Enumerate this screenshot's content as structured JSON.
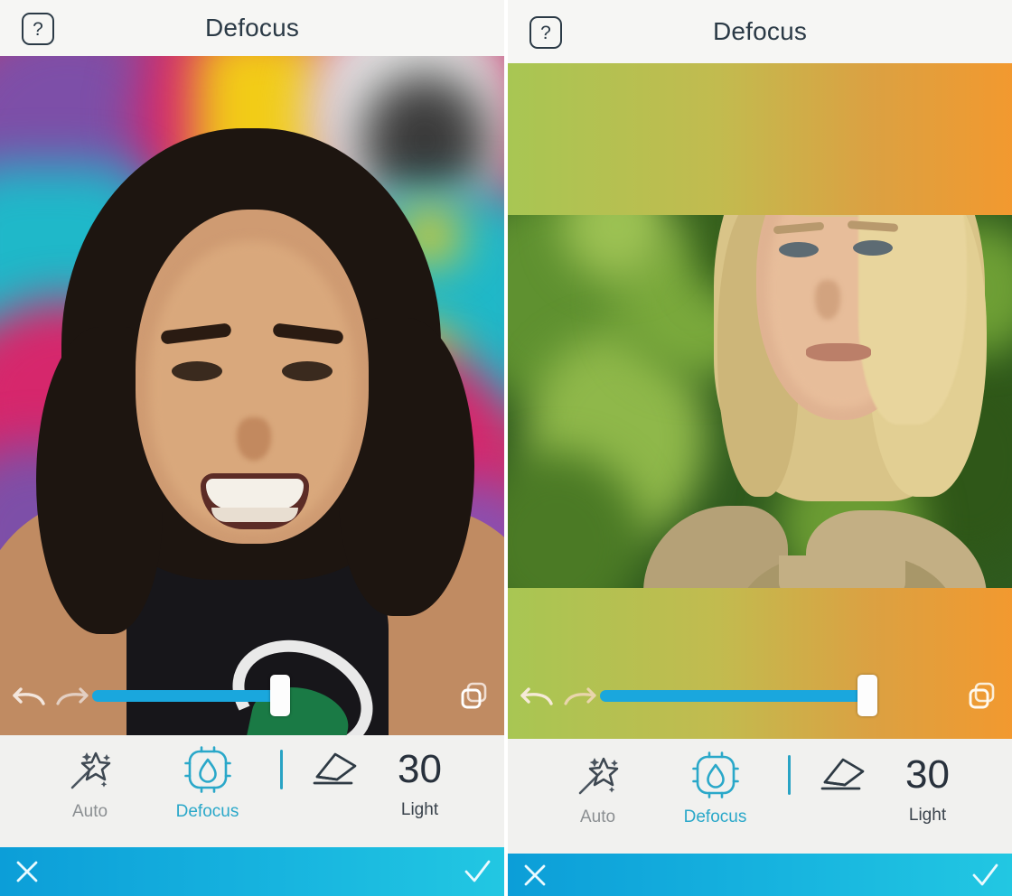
{
  "app": {
    "screens": [
      {
        "id": "left-screen",
        "header": {
          "help_label": "?",
          "title": "Defocus"
        },
        "photo": {
          "subject": "portrait-woman-graffiti-wall",
          "background_colors": [
            "#7d4fa8",
            "#d6276c",
            "#f2cc17",
            "#1fb8c9",
            "#e8e8e8"
          ],
          "letterbox": false
        },
        "slider": {
          "undo_icon": "undo-arrow-icon",
          "redo_icon": "redo-arrow-icon",
          "compare_icon": "compare-layers-icon",
          "value": 52,
          "track_color": "#1aa7dd",
          "thumb_color": "#fdfdfd"
        },
        "tools": {
          "auto": {
            "icon": "magic-wand-icon",
            "label": "Auto",
            "active": false
          },
          "defocus": {
            "icon": "defocus-droplet-icon",
            "label": "Defocus",
            "active": true
          },
          "eraser": {
            "icon": "eraser-icon"
          },
          "amount": {
            "value": "30",
            "label": "Light"
          }
        },
        "actions": {
          "cancel_icon": "close-x-icon",
          "confirm_icon": "check-icon"
        }
      },
      {
        "id": "right-screen",
        "header": {
          "help_label": "?",
          "title": "Defocus"
        },
        "photo": {
          "subject": "portrait-blonde-woman-foliage",
          "background_colors": [
            "#2f5a1e",
            "#6d9b34",
            "#3f7a24",
            "#97b84b"
          ],
          "letterbox": true,
          "letterbox_gradient": [
            "#a8c653",
            "#c2bb4f",
            "#dba142",
            "#f2992f"
          ]
        },
        "slider": {
          "undo_icon": "undo-arrow-icon",
          "redo_icon": "redo-arrow-icon",
          "compare_icon": "compare-layers-icon",
          "value": 74,
          "track_color": "#1aa7dd",
          "thumb_color": "#fdfdfd"
        },
        "tools": {
          "auto": {
            "icon": "magic-wand-icon",
            "label": "Auto",
            "active": false
          },
          "defocus": {
            "icon": "defocus-droplet-icon",
            "label": "Defocus",
            "active": true
          },
          "eraser": {
            "icon": "eraser-icon"
          },
          "amount": {
            "value": "30",
            "label": "Light"
          }
        },
        "actions": {
          "cancel_icon": "close-x-icon",
          "confirm_icon": "check-icon"
        }
      }
    ],
    "theme": {
      "accent": "#2aa8c9",
      "slider_blue": "#1aa7dd",
      "actionbar_from": "#0c9ed8",
      "actionbar_to": "#22c7e2",
      "text_dark": "#2b3a46",
      "text_muted": "#8b8f92",
      "chrome_bg": "#f1f1ef"
    }
  }
}
